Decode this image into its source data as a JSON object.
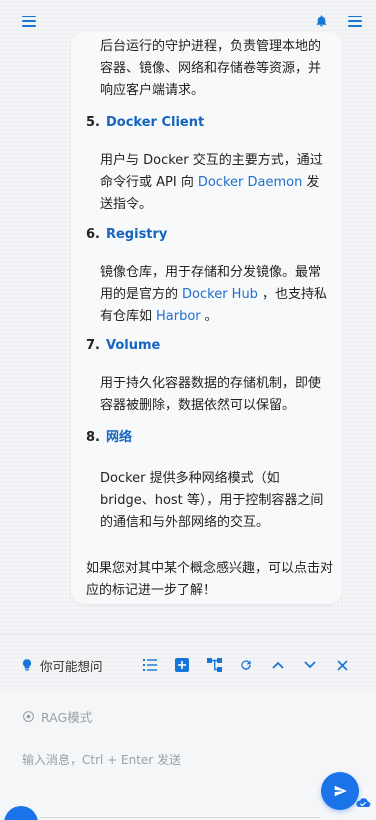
{
  "topbar": {
    "left_icon": "menu-icon",
    "right_icons": [
      "bell-icon",
      "menu-icon"
    ]
  },
  "message": {
    "intro_paragraph": "后台运行的守护进程，负责管理本地的容器、镜像、网络和存储卷等资源，并响应客户端请求。",
    "items": [
      {
        "number": "5.",
        "title": "Docker Client",
        "text_before": "用户与 Docker 交互的主要方式，通过命令行或 API 向",
        "link": "Docker Daemon",
        "text_after": "发送指令。"
      },
      {
        "number": "6.",
        "title": "Registry",
        "text_before": "镜像仓库，用于存储和分发镜像。最常用的是官方的",
        "link": "Docker Hub",
        "text_middle": "，也支持私有仓库如",
        "link2": "Harbor",
        "text_after": "。"
      },
      {
        "number": "7.",
        "title": "Volume",
        "text": "用于持久化容器数据的存储机制，即使容器被删除，数据依然可以保留。"
      },
      {
        "number": "8.",
        "title": "网络",
        "text": "Docker 提供多种网络模式（如 bridge、host 等），用于控制容器之间的通信和与外部网络的交互。"
      }
    ],
    "closing": "如果您对其中某个概念感兴趣，可以点击对应的标记进一步了解！"
  },
  "suggest": {
    "label": "你可能想问",
    "tools": [
      "list-icon",
      "add-box-icon",
      "branch-icon",
      "refresh-icon",
      "chevron-up-icon",
      "chevron-down-icon",
      "close-icon"
    ]
  },
  "input": {
    "rag_label": "RAG模式",
    "placeholder": "输入消息，Ctrl + Enter 发送"
  },
  "colors": {
    "accent": "#1a73e8",
    "link": "#1e6fcf",
    "heading": "#1565c0"
  }
}
